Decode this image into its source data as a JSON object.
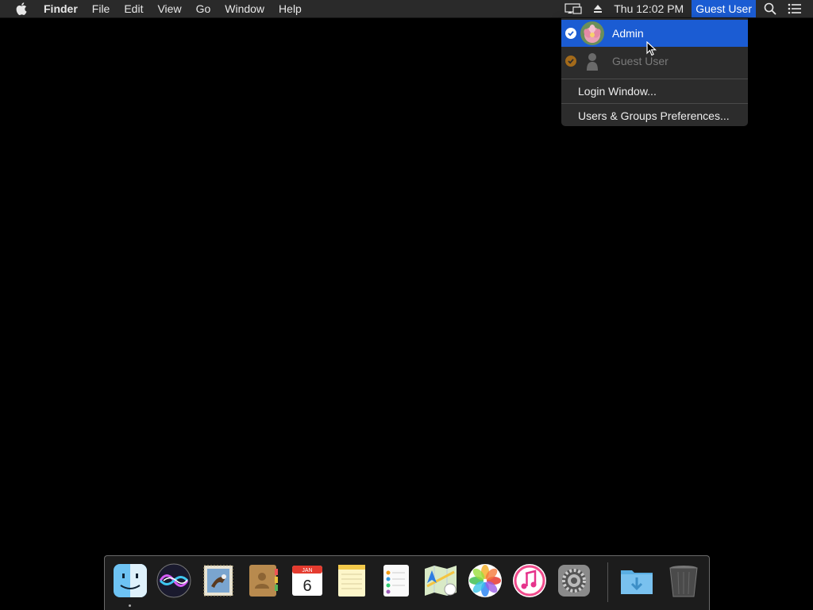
{
  "menubar": {
    "app_name": "Finder",
    "menus": [
      "File",
      "Edit",
      "View",
      "Go",
      "Window",
      "Help"
    ],
    "clock": "Thu 12:02 PM",
    "current_user": "Guest User"
  },
  "user_menu": {
    "users": [
      {
        "name": "Admin",
        "highlighted": true
      },
      {
        "name": "Guest User",
        "highlighted": false
      }
    ],
    "login_window": "Login Window...",
    "users_groups_prefs": "Users & Groups Preferences..."
  },
  "dock": {
    "calendar_month": "JAN",
    "calendar_day": "6",
    "apps": [
      "finder-icon",
      "siri-icon",
      "mail-icon",
      "contacts-icon",
      "calendar-icon",
      "notes-icon",
      "reminders-icon",
      "maps-icon",
      "photos-icon",
      "itunes-icon",
      "system-preferences-icon",
      "downloads-folder-icon",
      "trash-icon"
    ]
  },
  "colors": {
    "menubar_bg": "#2a2a2a",
    "highlight": "#1b5cd3",
    "dropdown_bg": "#2c2c2c",
    "desktop_bg": "#000000"
  }
}
